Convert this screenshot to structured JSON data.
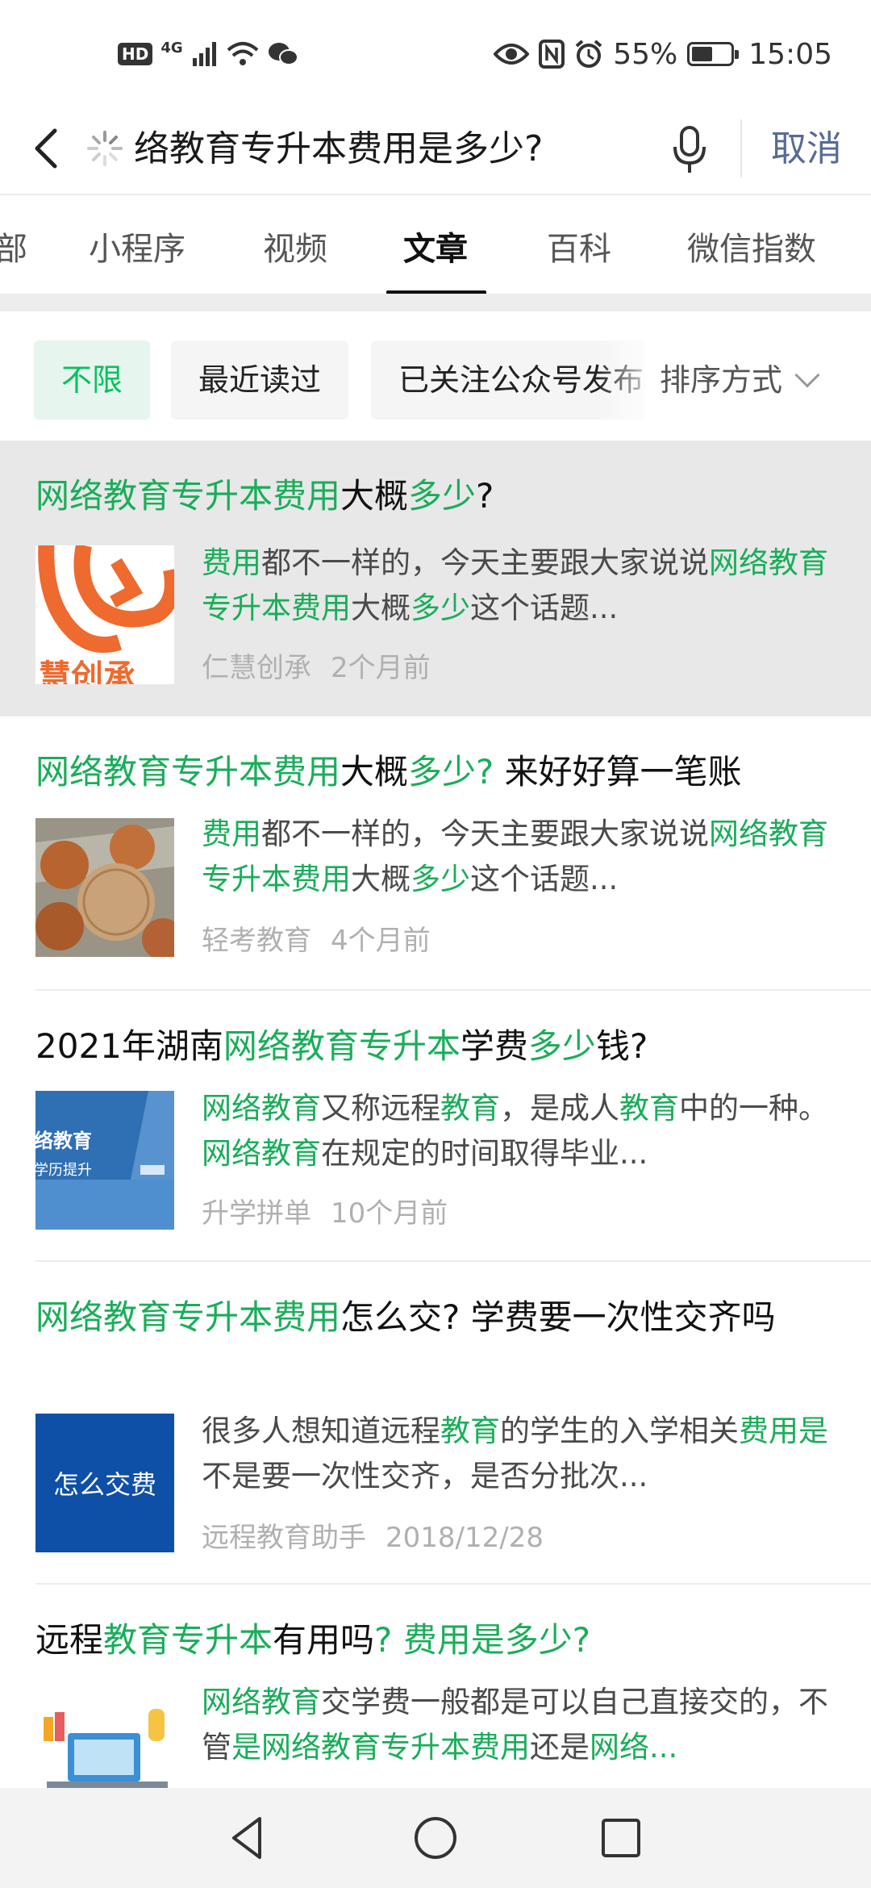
{
  "status_bar": {
    "hd": "HD",
    "network": "4G",
    "battery_text": "55%",
    "battery_level": 0.55,
    "time": "15:05"
  },
  "search": {
    "query": "络教育专升本费用是多少?",
    "cancel_label": "取消"
  },
  "tabs": [
    {
      "label": "部"
    },
    {
      "label": "小程序"
    },
    {
      "label": "视频"
    },
    {
      "label": "文章"
    },
    {
      "label": "百科"
    },
    {
      "label": "微信指数"
    }
  ],
  "active_tab": "文章",
  "filters": {
    "chips": [
      {
        "label": "不限"
      },
      {
        "label": "最近读过"
      },
      {
        "label": "已关注公众号发布"
      }
    ],
    "sort_label": "排序方式"
  },
  "results": [
    {
      "title": [
        {
          "text": "网络教育专升本费用",
          "hl": true
        },
        {
          "text": "大概",
          "hl": false
        },
        {
          "text": "多少",
          "hl": true
        },
        {
          "text": "?",
          "hl": false
        }
      ],
      "snippet": [
        {
          "text": "费用",
          "hl": true
        },
        {
          "text": "都不一样的，今天主要跟大家说说",
          "hl": false
        },
        {
          "text": "网络教育专升本费用",
          "hl": true
        },
        {
          "text": "大概",
          "hl": false
        },
        {
          "text": "多少",
          "hl": true
        },
        {
          "text": "这个话题...",
          "hl": false
        }
      ],
      "source": "仁慧创承",
      "date": "2个月前",
      "thumb_text": "慧创承"
    },
    {
      "title": [
        {
          "text": "网络教育专升本费用",
          "hl": true
        },
        {
          "text": "大概",
          "hl": false
        },
        {
          "text": "多少?",
          "hl": true
        },
        {
          "text": " 来好好算一笔账",
          "hl": false
        }
      ],
      "snippet": [
        {
          "text": "费用",
          "hl": true
        },
        {
          "text": "都不一样的，今天主要跟大家说说",
          "hl": false
        },
        {
          "text": "网络教育专升本费用",
          "hl": true
        },
        {
          "text": "大概",
          "hl": false
        },
        {
          "text": "多少",
          "hl": true
        },
        {
          "text": "这个话题...",
          "hl": false
        }
      ],
      "source": "轻考教育",
      "date": "4个月前"
    },
    {
      "title": [
        {
          "text": "2021年湖南",
          "hl": false
        },
        {
          "text": "网络教育专升本",
          "hl": true
        },
        {
          "text": "学费",
          "hl": false
        },
        {
          "text": "多少",
          "hl": true
        },
        {
          "text": "钱?",
          "hl": false
        }
      ],
      "snippet": [
        {
          "text": "网络教育",
          "hl": true
        },
        {
          "text": "又称远程",
          "hl": false
        },
        {
          "text": "教育",
          "hl": true
        },
        {
          "text": "，是成人",
          "hl": false
        },
        {
          "text": "教育",
          "hl": true
        },
        {
          "text": "中的一种。 ",
          "hl": false
        },
        {
          "text": "网络教育",
          "hl": true
        },
        {
          "text": "在规定的时间取得毕业...",
          "hl": false
        }
      ],
      "source": "升学拼单",
      "date": "10个月前",
      "thumb_lines": [
        "络教育",
        "学历提升"
      ]
    },
    {
      "title": [
        {
          "text": "网络教育专升本费用",
          "hl": true
        },
        {
          "text": "怎么交? 学费要一次性交齐吗",
          "hl": false
        }
      ],
      "snippet": [
        {
          "text": "很多人想知道远程",
          "hl": false
        },
        {
          "text": "教育",
          "hl": true
        },
        {
          "text": "的学生的入学相关",
          "hl": false
        },
        {
          "text": "费用是",
          "hl": true
        },
        {
          "text": "不是要一次性交齐，是否分批次...",
          "hl": false
        }
      ],
      "source": "远程教育助手",
      "date": "2018/12/28",
      "thumb_text": "怎么交费"
    },
    {
      "title": [
        {
          "text": "远程",
          "hl": false
        },
        {
          "text": "教育专升本",
          "hl": true
        },
        {
          "text": "有用吗",
          "hl": false
        },
        {
          "text": "? 费用是多少?",
          "hl": true
        }
      ],
      "snippet": [
        {
          "text": "网络教育",
          "hl": true
        },
        {
          "text": "交学费一般都是可以自己直接交的，不管",
          "hl": false
        },
        {
          "text": "是网络教育专升本费用",
          "hl": true
        },
        {
          "text": "还是",
          "hl": false
        },
        {
          "text": "网络...",
          "hl": true
        }
      ]
    }
  ],
  "colors": {
    "highlight": "#1aad5a",
    "accent_green": "#07c160",
    "cancel_blue": "#576b95",
    "thumb4_blue": "#0e4fa8"
  }
}
